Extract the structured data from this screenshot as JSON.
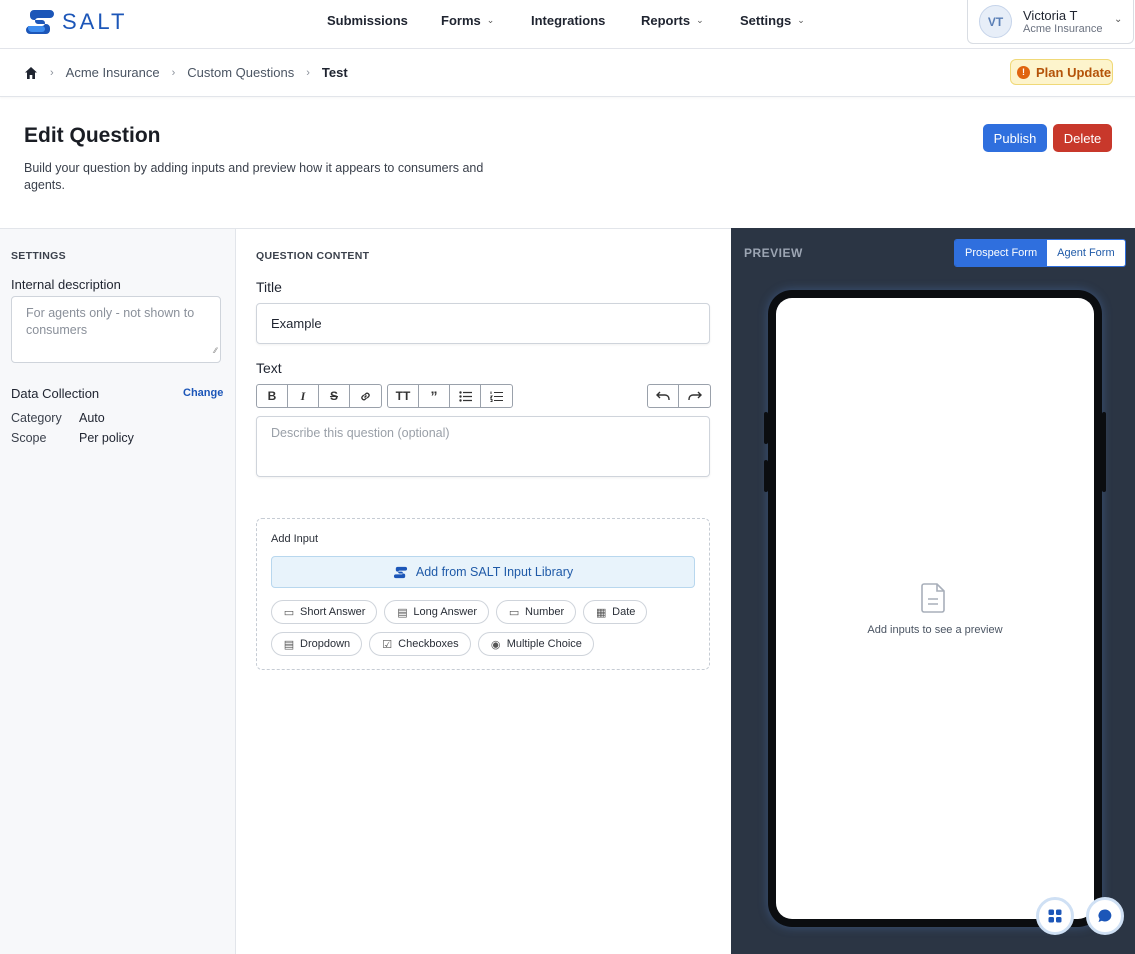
{
  "app": {
    "logo_text": "SALT"
  },
  "nav": {
    "items": [
      {
        "label": "Submissions",
        "has_menu": false
      },
      {
        "label": "Forms",
        "has_menu": true
      },
      {
        "label": "Integrations",
        "has_menu": false
      },
      {
        "label": "Reports",
        "has_menu": true
      },
      {
        "label": "Settings",
        "has_menu": true
      }
    ]
  },
  "user": {
    "initials": "VT",
    "name": "Victoria T",
    "org": "Acme Insurance"
  },
  "breadcrumb": {
    "items": [
      "Acme Insurance",
      "Custom Questions"
    ],
    "current": "Test"
  },
  "plan_badge": {
    "label": "Plan Update",
    "icon": "exclamation-icon"
  },
  "page": {
    "title": "Edit Question",
    "description": "Build your question by adding inputs and preview how it appears to consumers and agents.",
    "publish_label": "Publish",
    "delete_label": "Delete"
  },
  "settings": {
    "heading": "SETTINGS",
    "internal_description_label": "Internal description",
    "internal_description_placeholder": "For agents only - not shown to consumers",
    "data_collection_label": "Data Collection",
    "change_label": "Change",
    "category_key": "Category",
    "category_value": "Auto",
    "scope_key": "Scope",
    "scope_value": "Per policy"
  },
  "content": {
    "heading": "QUESTION CONTENT",
    "title_label": "Title",
    "title_value": "Example",
    "text_label": "Text",
    "text_placeholder": "Describe this question (optional)",
    "toolbar_icons": [
      "bold-icon",
      "italic-icon",
      "strikethrough-icon",
      "link-icon",
      "heading-icon",
      "quote-icon",
      "bullet-list-icon",
      "numbered-list-icon",
      "undo-icon",
      "redo-icon"
    ],
    "add_input_label": "Add Input",
    "library_button_label": "Add from SALT Input Library",
    "input_types_row1": [
      {
        "label": "Short Answer",
        "icon": "short-answer-icon"
      },
      {
        "label": "Long Answer",
        "icon": "long-answer-icon"
      },
      {
        "label": "Number",
        "icon": "number-icon"
      },
      {
        "label": "Date",
        "icon": "calendar-icon"
      }
    ],
    "input_types_row2": [
      {
        "label": "Dropdown",
        "icon": "dropdown-icon"
      },
      {
        "label": "Checkboxes",
        "icon": "checkbox-icon"
      },
      {
        "label": "Multiple Choice",
        "icon": "radio-icon"
      }
    ]
  },
  "preview": {
    "heading": "PREVIEW",
    "tabs": [
      {
        "label": "Prospect Form",
        "active": true
      },
      {
        "label": "Agent Form",
        "active": false
      }
    ],
    "empty_text": "Add inputs to see a preview"
  },
  "colors": {
    "brand_blue": "#1c56b8",
    "publish": "#2f6fde",
    "delete": "#c8382b",
    "preview_bg": "#2b3544",
    "plan_badge_bg": "#fdf4cc"
  }
}
